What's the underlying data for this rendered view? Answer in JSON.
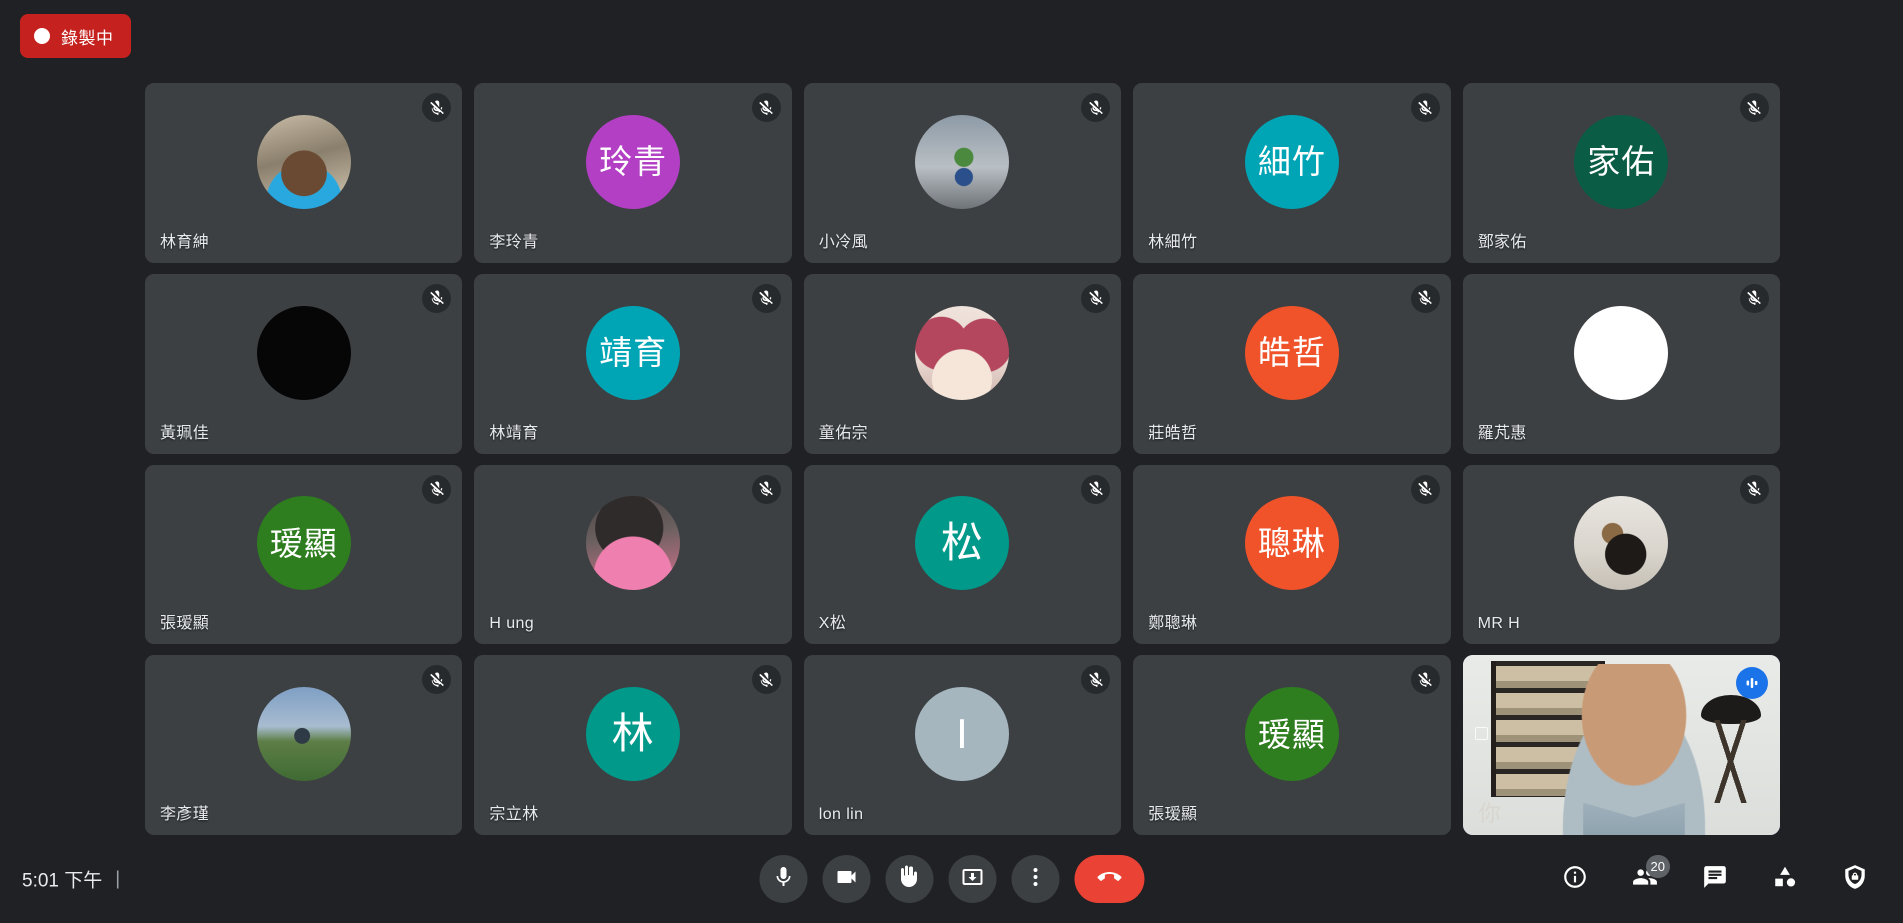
{
  "recording": {
    "label": "錄製中",
    "color": "#c5221f",
    "icon": "record-dot-icon"
  },
  "self_view": {
    "overlay_text": "你",
    "speaking_icon": "audio-level-icon",
    "active_border_color": "#8ab4f8"
  },
  "grid": {
    "tiles": [
      {
        "name": "林育紳",
        "avatar_type": "photo",
        "photo": "ph-baby",
        "initials": "",
        "color": "",
        "muted": true
      },
      {
        "name": "李玲青",
        "avatar_type": "initials",
        "photo": "",
        "initials": "玲青",
        "color": "#b23fc4",
        "muted": true
      },
      {
        "name": "小冷風",
        "avatar_type": "photo",
        "photo": "ph-street",
        "initials": "",
        "color": "",
        "muted": true
      },
      {
        "name": "林細竹",
        "avatar_type": "initials",
        "photo": "",
        "initials": "細竹",
        "color": "#00a5b5",
        "muted": true
      },
      {
        "name": "鄧家佑",
        "avatar_type": "initials",
        "photo": "",
        "initials": "家佑",
        "color": "#0b5c45",
        "muted": true
      },
      {
        "name": "黃珮佳",
        "avatar_type": "initials",
        "photo": "",
        "initials": "",
        "color": "#060606",
        "muted": true
      },
      {
        "name": "林靖育",
        "avatar_type": "initials",
        "photo": "",
        "initials": "靖育",
        "color": "#00a5b5",
        "muted": true
      },
      {
        "name": "童佑宗",
        "avatar_type": "photo",
        "photo": "ph-anime",
        "initials": "",
        "color": "",
        "muted": true
      },
      {
        "name": "莊皓哲",
        "avatar_type": "initials",
        "photo": "",
        "initials": "皓哲",
        "color": "#f0522a",
        "muted": true
      },
      {
        "name": "羅芃惠",
        "avatar_type": "initials",
        "photo": "",
        "initials": "",
        "color": "#ffffff",
        "muted": true
      },
      {
        "name": "張瑷顯",
        "avatar_type": "initials",
        "photo": "",
        "initials": "瑷顯",
        "color": "#2e7d1f",
        "muted": true
      },
      {
        "name": "H ung",
        "avatar_type": "photo",
        "photo": "ph-hair",
        "initials": "",
        "color": "",
        "muted": true
      },
      {
        "name": "X松",
        "avatar_type": "initials",
        "photo": "",
        "initials": "松",
        "color": "#00998a",
        "muted": true
      },
      {
        "name": "鄭聰琳",
        "avatar_type": "initials",
        "photo": "",
        "initials": "聰琳",
        "color": "#f0522a",
        "muted": true
      },
      {
        "name": "MR H",
        "avatar_type": "photo",
        "photo": "ph-dog",
        "initials": "",
        "color": "",
        "muted": true
      },
      {
        "name": "李彥瑾",
        "avatar_type": "photo",
        "photo": "ph-field",
        "initials": "",
        "color": "",
        "muted": true
      },
      {
        "name": "宗立林",
        "avatar_type": "initials",
        "photo": "",
        "initials": "林",
        "color": "#00998a",
        "muted": true
      },
      {
        "name": "lon lin",
        "avatar_type": "initials",
        "photo": "",
        "initials": "I",
        "color": "#a5b6bf",
        "muted": true
      },
      {
        "name": "張瑷顯",
        "avatar_type": "initials",
        "photo": "",
        "initials": "瑷顯",
        "color": "#2e7d1f",
        "muted": true
      }
    ]
  },
  "bottombar": {
    "time": "5:01 下午",
    "separator": "|",
    "meeting_code": "",
    "center_controls": [
      {
        "name": "microphone-button",
        "icon": "mic-icon",
        "style": "default"
      },
      {
        "name": "camera-button",
        "icon": "video-camera-icon",
        "style": "default"
      },
      {
        "name": "raise-hand-button",
        "icon": "hand-icon",
        "style": "default"
      },
      {
        "name": "present-now-button",
        "icon": "present-screen-icon",
        "style": "default"
      },
      {
        "name": "more-options-button",
        "icon": "more-vertical-icon",
        "style": "default"
      },
      {
        "name": "leave-call-button",
        "icon": "end-call-icon",
        "style": "leave"
      }
    ],
    "right_controls": [
      {
        "name": "meeting-details-button",
        "icon": "info-icon",
        "badge": ""
      },
      {
        "name": "participants-button",
        "icon": "people-icon",
        "badge": "20"
      },
      {
        "name": "chat-button",
        "icon": "chat-bubble-icon",
        "badge": ""
      },
      {
        "name": "activities-button",
        "icon": "activities-icon",
        "badge": ""
      },
      {
        "name": "host-controls-button",
        "icon": "shield-lock-icon",
        "badge": ""
      }
    ]
  }
}
